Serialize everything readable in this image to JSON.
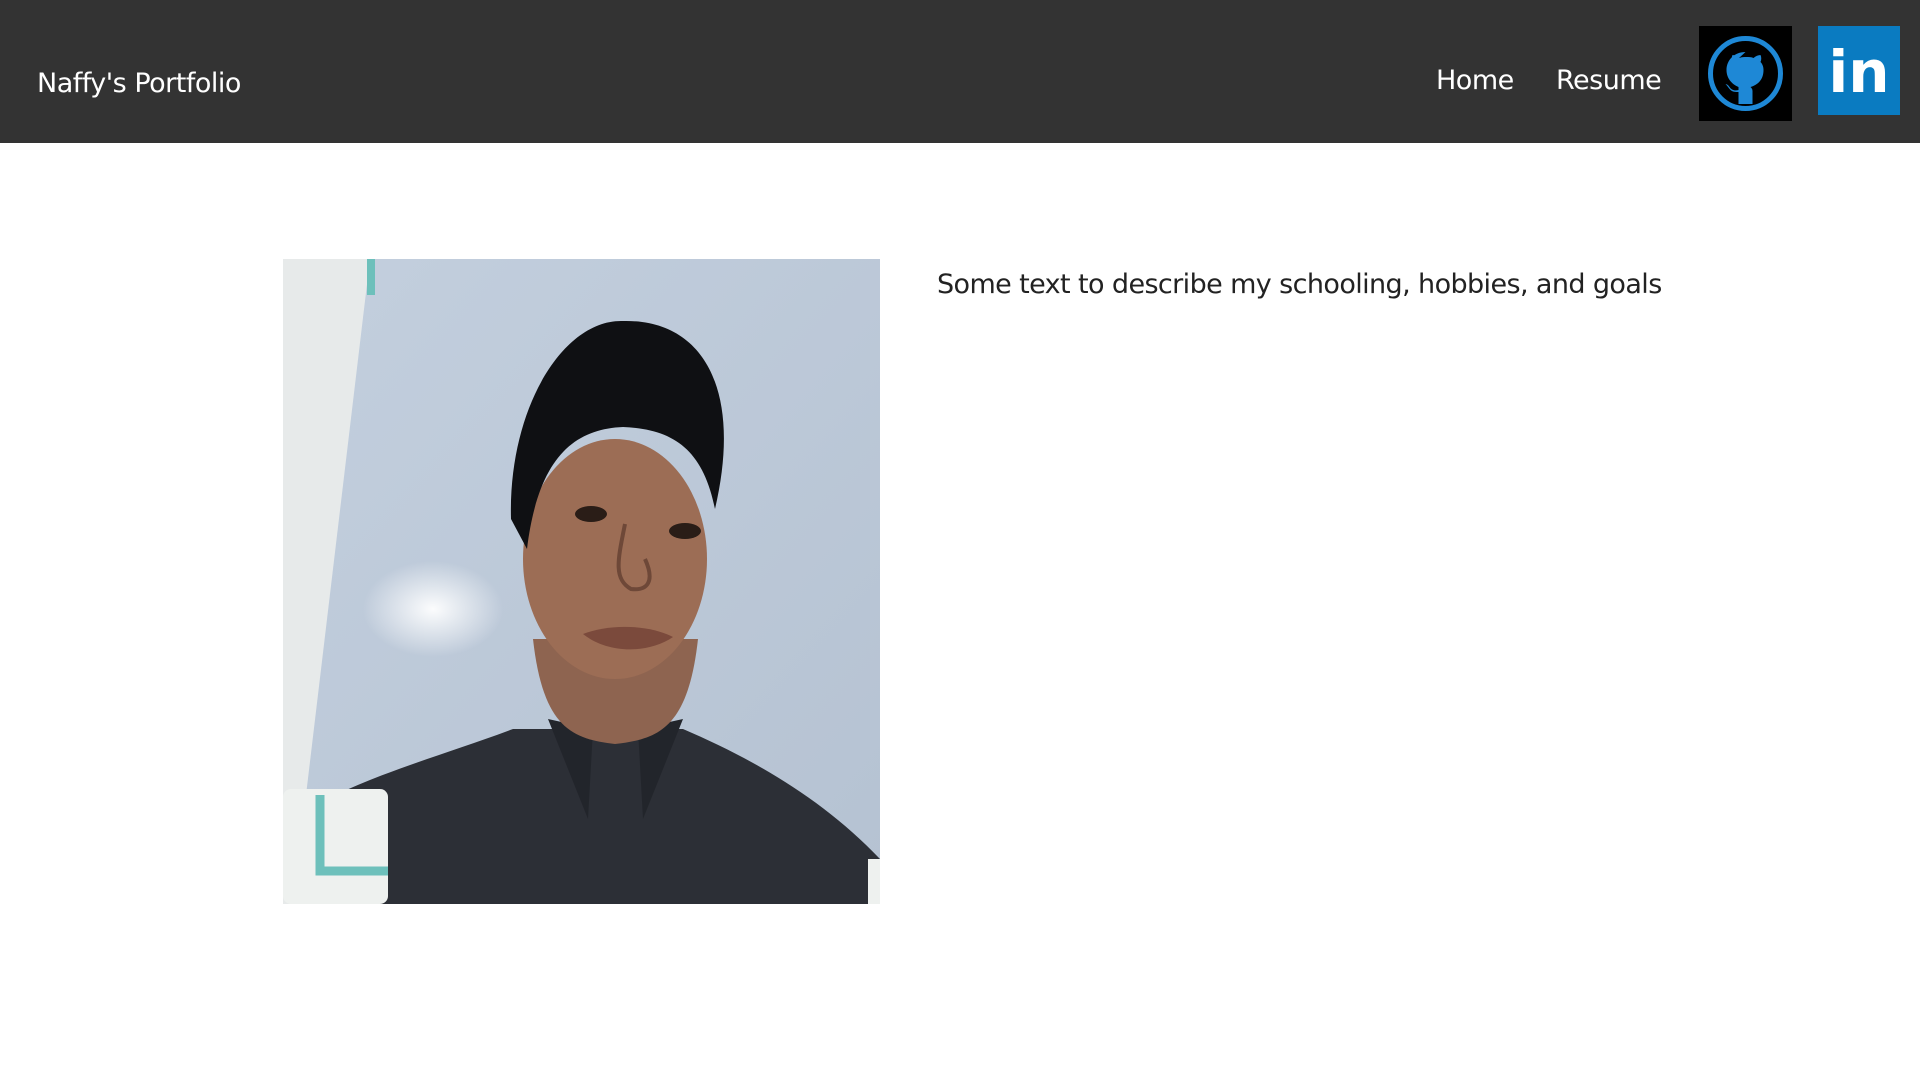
{
  "navbar": {
    "brand": "Naffy's Portfolio",
    "links": [
      {
        "label": "Home"
      },
      {
        "label": "Resume"
      }
    ],
    "social": [
      {
        "icon": "github-icon",
        "color": "#1e88d6",
        "background": "#000000"
      },
      {
        "icon": "linkedin-icon",
        "text": "in",
        "color": "#ffffff",
        "background": "#0a7bc1"
      }
    ],
    "background": "#333333"
  },
  "main": {
    "photo": {
      "icon": "profile-photo"
    },
    "bio": "Some text to describe my schooling, hobbies, and goals"
  }
}
